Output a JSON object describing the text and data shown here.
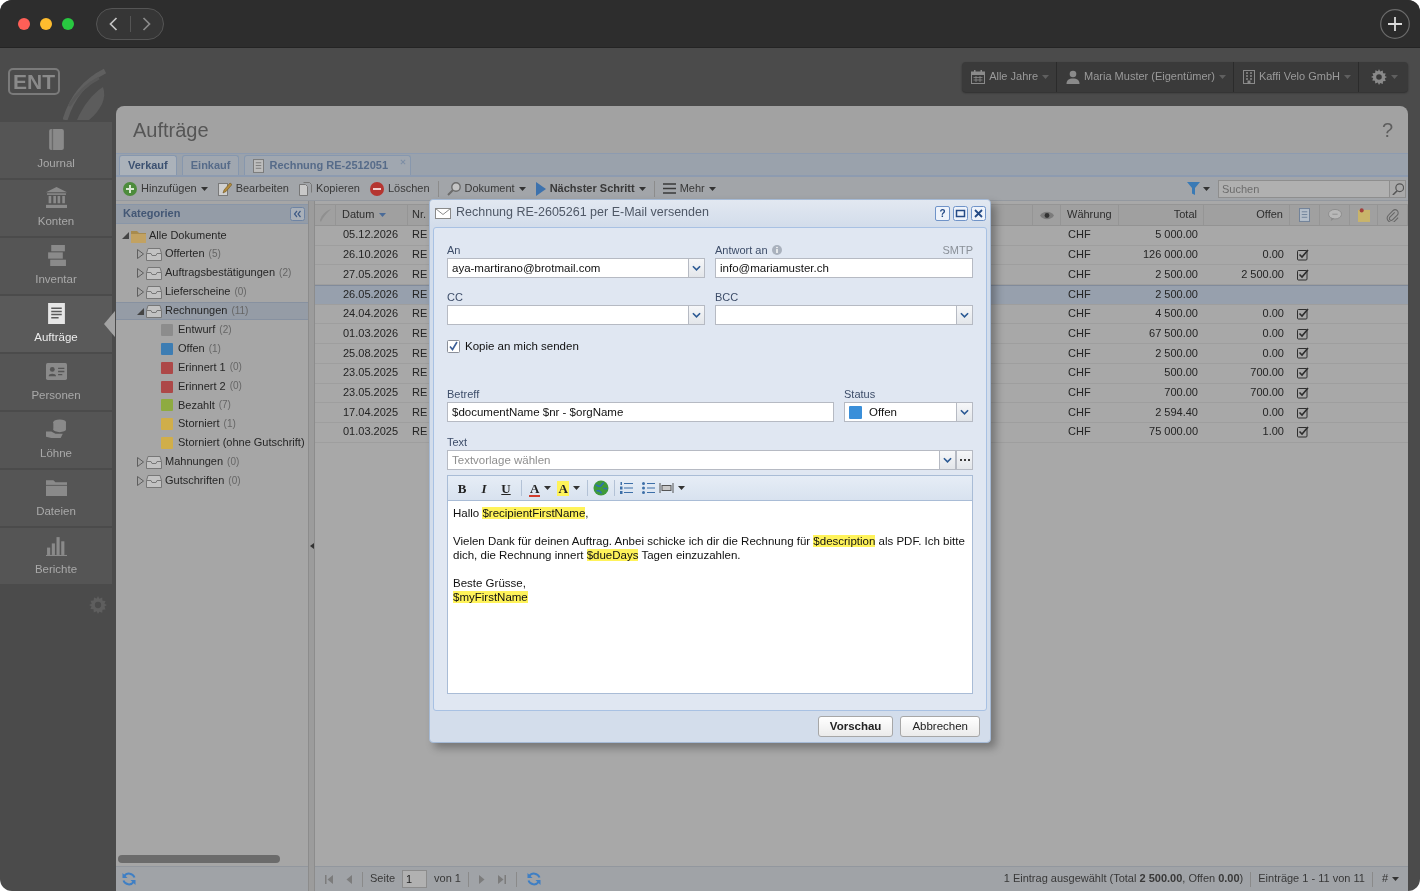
{
  "logo": {
    "text": "ENT"
  },
  "sidebar": {
    "items": [
      {
        "label": "Journal",
        "kind": "journal",
        "selected": false
      },
      {
        "label": "Konten",
        "kind": "accounts",
        "selected": false
      },
      {
        "label": "Inventar",
        "kind": "inventory",
        "selected": false
      },
      {
        "label": "Aufträge",
        "kind": "orders",
        "selected": true
      },
      {
        "label": "Personen",
        "kind": "people",
        "selected": false
      },
      {
        "label": "Löhne",
        "kind": "payroll",
        "selected": false
      },
      {
        "label": "Dateien",
        "kind": "files",
        "selected": false
      },
      {
        "label": "Berichte",
        "kind": "reports",
        "selected": false
      }
    ]
  },
  "top_menu": [
    {
      "label": "Alle Jahre",
      "kind": "year"
    },
    {
      "label": "Maria Muster (Eigentümer)",
      "kind": "user"
    },
    {
      "label": "Kaffi Velo GmbH",
      "kind": "company"
    }
  ],
  "page": {
    "title": "Aufträge",
    "help": "?"
  },
  "tabs": [
    {
      "label": "Verkauf",
      "selected": true
    },
    {
      "label": "Einkauf",
      "selected": false
    },
    {
      "label": "Rechnung RE-2512051",
      "selected": false,
      "kind": "document",
      "closable": true
    }
  ],
  "toolbar": {
    "groups": [
      [
        {
          "label": "Hinzufügen",
          "kind": "add",
          "dropdown": true
        },
        {
          "label": "Bearbeiten",
          "kind": "edit",
          "dropdown": false
        },
        {
          "label": "Kopieren",
          "kind": "copy",
          "dropdown": false
        },
        {
          "label": "Löschen",
          "kind": "delete",
          "dropdown": false
        }
      ],
      [
        {
          "label": "Dokument",
          "kind": "document",
          "dropdown": true
        },
        {
          "label": "Nächster Schritt",
          "kind": "next",
          "dropdown": true,
          "bold": true
        }
      ],
      [
        {
          "label": "Mehr",
          "kind": "more",
          "dropdown": true
        }
      ]
    ],
    "search": {
      "placeholder": "Suchen"
    }
  },
  "categories": {
    "title": "Kategorien",
    "tree": [
      {
        "label": "Alle Dokumente",
        "kind": "root",
        "expanded": true,
        "selected": false,
        "children": [
          {
            "label": "Offerten",
            "count": "(5)",
            "kind": "group",
            "expanded": false,
            "selected": false
          },
          {
            "label": "Auftragsbestätigungen",
            "count": "(2)",
            "kind": "group",
            "expanded": false,
            "selected": false
          },
          {
            "label": "Lieferscheine",
            "count": "(0)",
            "kind": "group",
            "expanded": false,
            "selected": false
          },
          {
            "label": "Rechnungen",
            "count": "(11)",
            "kind": "group",
            "expanded": true,
            "selected": true,
            "children": [
              {
                "label": "Entwurf",
                "count": "(2)",
                "kind": "status",
                "color": "#8c8c8c",
                "selected": false
              },
              {
                "label": "Offen",
                "count": "(1)",
                "kind": "status",
                "color": "#3d7db3",
                "selected": false
              },
              {
                "label": "Erinnert 1",
                "count": "(0)",
                "kind": "status",
                "color": "#ad4848",
                "selected": false
              },
              {
                "label": "Erinnert 2",
                "count": "(0)",
                "kind": "status",
                "color": "#ad4848",
                "selected": false
              },
              {
                "label": "Bezahlt",
                "count": "(7)",
                "kind": "status",
                "color": "#8eab40",
                "selected": false
              },
              {
                "label": "Storniert",
                "count": "(1)",
                "kind": "status",
                "color": "#d0ae4a",
                "selected": false
              },
              {
                "label": "Storniert (ohne Gutschrift)",
                "kind": "status",
                "color": "#d0ae4a",
                "selected": false
              }
            ]
          },
          {
            "label": "Mahnungen",
            "count": "(0)",
            "kind": "group",
            "expanded": false,
            "selected": false
          },
          {
            "label": "Gutschriften",
            "count": "(0)",
            "kind": "group",
            "expanded": false,
            "selected": false
          }
        ]
      }
    ]
  },
  "grid": {
    "columns": [
      {
        "label": "Datum",
        "sorted": true
      },
      {
        "label": "Nr.",
        "sorted": false
      },
      {
        "label": "Währung",
        "sorted": false
      },
      {
        "label": "Total",
        "sorted": false
      },
      {
        "label": "Offen",
        "sorted": false
      }
    ],
    "rows": [
      {
        "date": "05.12.2026",
        "number": "RE",
        "currency": "CHF",
        "total": "5 000.00",
        "checked": false,
        "selected": false
      },
      {
        "date": "26.10.2026",
        "number": "RE",
        "currency": "CHF",
        "total": "126 000.00",
        "open": "0.00",
        "checked": true,
        "selected": false
      },
      {
        "date": "27.05.2026",
        "number": "RE",
        "currency": "CHF",
        "total": "2 500.00",
        "open": "2 500.00",
        "checked": true,
        "selected": false
      },
      {
        "date": "26.05.2026",
        "number": "RE",
        "currency": "CHF",
        "total": "2 500.00",
        "checked": false,
        "selected": true
      },
      {
        "date": "24.04.2026",
        "number": "RE",
        "currency": "CHF",
        "total": "4 500.00",
        "open": "0.00",
        "checked": true,
        "selected": false
      },
      {
        "date": "01.03.2026",
        "number": "RE",
        "currency": "CHF",
        "total": "67 500.00",
        "open": "0.00",
        "checked": true,
        "selected": false
      },
      {
        "date": "25.08.2025",
        "number": "RE",
        "currency": "CHF",
        "total": "2 500.00",
        "open": "0.00",
        "checked": true,
        "selected": false
      },
      {
        "date": "23.05.2025",
        "number": "RE",
        "currency": "CHF",
        "total": "500.00",
        "open": "700.00",
        "checked": true,
        "selected": false
      },
      {
        "date": "23.05.2025",
        "number": "RE",
        "currency": "CHF",
        "total": "700.00",
        "open": "700.00",
        "checked": true,
        "selected": false
      },
      {
        "date": "17.04.2025",
        "number": "RE",
        "currency": "CHF",
        "total": "2 594.40",
        "open": "0.00",
        "checked": true,
        "selected": false
      },
      {
        "date": "01.03.2025",
        "number": "RE",
        "currency": "CHF",
        "total": "75 000.00",
        "open": "1.00",
        "checked": true,
        "selected": false
      }
    ]
  },
  "status_bar": {
    "navigation_disabled": true,
    "page_label": "Seite",
    "page": "1",
    "page_count": "von 1",
    "summary": "1 Eintrag ausgewählt (Total **2 500.00**, Offen **0.00**)",
    "entries": "Einträge 1 - 11 von 11",
    "column_menu": "#"
  },
  "dialog": {
    "title": "Rechnung RE-2605261 per E-Mail versenden",
    "help": "?",
    "to": {
      "label": "An",
      "value": "aya-martirano@brotmail.com"
    },
    "reply_to": {
      "label": "Antwort an",
      "value": "info@mariamuster.ch",
      "note": "SMTP"
    },
    "cc": {
      "label": "CC"
    },
    "bcc": {
      "label": "BCC"
    },
    "copy_to_me": {
      "label": "Kopie an mich senden",
      "checked": true
    },
    "subject": {
      "label": "Betreff",
      "value": "$documentName $nr - $orgName"
    },
    "status": {
      "label": "Status",
      "value": "Offen",
      "color": "#3a8fd9"
    },
    "text_template": {
      "label": "Text",
      "placeholder": "Textvorlage wählen"
    },
    "editor": {
      "toolbar": [
        {
          "label": "B",
          "kind": "bold"
        },
        {
          "label": "I",
          "kind": "italic"
        },
        {
          "label": "U",
          "kind": "underline"
        },
        {
          "label": "A",
          "kind": "font-color"
        },
        {
          "label": "A",
          "kind": "highlight"
        }
      ],
      "paragraphs": [
        {
          "lines": [
            [
              {
                "text": "Hallo ",
                "kind": "plain"
              },
              {
                "text": "$recipientFirstName",
                "kind": "variable"
              },
              {
                "text": ",",
                "kind": "plain"
              }
            ]
          ]
        },
        {
          "lines": [
            [
              {
                "text": "Vielen Dank für deinen Auftrag. Anbei schicke ich dir die Rechnung für ",
                "kind": "plain"
              },
              {
                "text": "$description",
                "kind": "variable"
              },
              {
                "text": " als PDF. Ich bitte dich, die Rechnung innert ",
                "kind": "plain"
              },
              {
                "text": "$dueDays",
                "kind": "variable"
              },
              {
                "text": " Tagen einzuzahlen.",
                "kind": "plain"
              }
            ]
          ]
        },
        {
          "lines": [
            [
              {
                "text": "Beste Grüsse,",
                "kind": "plain"
              }
            ],
            [
              {
                "text": "$myFirstName",
                "kind": "variable"
              }
            ]
          ]
        }
      ]
    },
    "buttons": [
      {
        "label": "Vorschau",
        "default": true
      },
      {
        "label": "Abbrechen",
        "default": false
      }
    ]
  }
}
